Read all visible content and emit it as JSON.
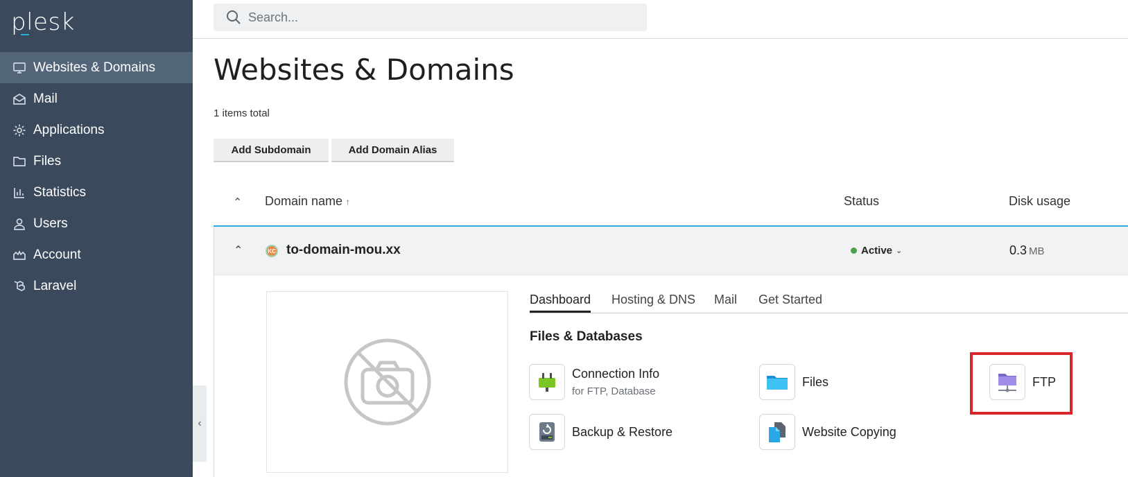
{
  "app": {
    "logo": "plesk",
    "accent": "#28aade"
  },
  "sidebar": {
    "items": [
      {
        "label": "Websites & Domains",
        "icon": "monitor-icon",
        "active": true
      },
      {
        "label": "Mail",
        "icon": "mail-icon"
      },
      {
        "label": "Applications",
        "icon": "gear-icon"
      },
      {
        "label": "Files",
        "icon": "folder-icon"
      },
      {
        "label": "Statistics",
        "icon": "bar-chart-icon"
      },
      {
        "label": "Users",
        "icon": "user-icon"
      },
      {
        "label": "Account",
        "icon": "account-icon"
      },
      {
        "label": "Laravel",
        "icon": "laravel-icon"
      }
    ],
    "collapse_glyph": "‹"
  },
  "search": {
    "placeholder": "Search..."
  },
  "page": {
    "title": "Websites & Domains",
    "items_total": "1 items total",
    "buttons": {
      "add_subdomain": "Add Subdomain",
      "add_domain_alias": "Add Domain Alias"
    }
  },
  "table": {
    "headers": {
      "domain": "Domain name",
      "sort_arrow": "↑",
      "status": "Status",
      "disk": "Disk usage"
    },
    "row": {
      "avatar": "KC",
      "domain": "to-domain-mou.xx",
      "status": "Active",
      "status_color": "#4ba24b",
      "disk_value": "0.3",
      "disk_unit": "MB"
    }
  },
  "panel": {
    "tabs": [
      "Dashboard",
      "Hosting & DNS",
      "Mail",
      "Get Started"
    ],
    "active_tab": "Dashboard",
    "section_title": "Files & Databases",
    "tools": {
      "connection_info": {
        "label": "Connection Info",
        "sub": "for FTP, Database",
        "icon": "plug-icon"
      },
      "files": {
        "label": "Files",
        "icon": "folder-icon"
      },
      "ftp": {
        "label": "FTP",
        "icon": "ftp-folder-icon"
      },
      "backup": {
        "label": "Backup & Restore",
        "icon": "backup-drive-icon"
      },
      "copying": {
        "label": "Website Copying",
        "icon": "copy-files-icon"
      }
    },
    "highlight_color": "#d9262d"
  }
}
